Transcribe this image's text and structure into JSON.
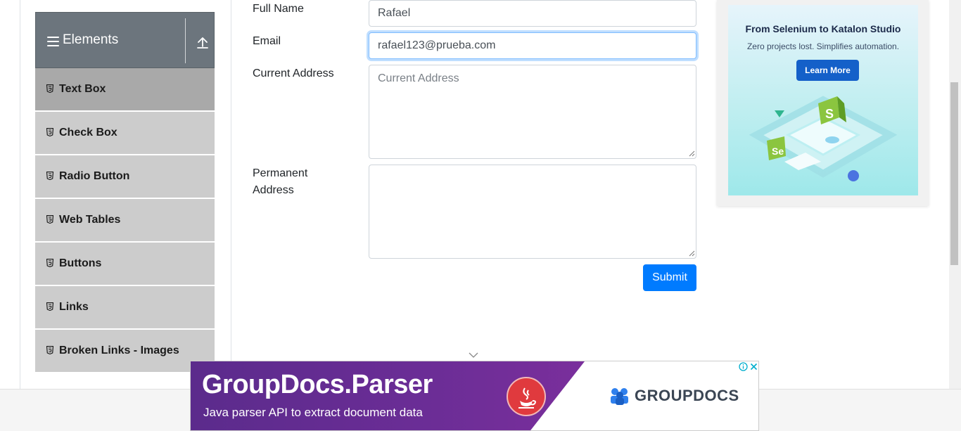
{
  "sidebar": {
    "group_title": "Elements",
    "items": [
      {
        "label": "Text Box",
        "active": true
      },
      {
        "label": "Check Box",
        "active": false
      },
      {
        "label": "Radio Button",
        "active": false
      },
      {
        "label": "Web Tables",
        "active": false
      },
      {
        "label": "Buttons",
        "active": false
      },
      {
        "label": "Links",
        "active": false
      },
      {
        "label": "Broken Links - Images",
        "active": false
      }
    ]
  },
  "form": {
    "full_name_label": "Full Name",
    "full_name_value": "Rafael",
    "email_label": "Email",
    "email_value": "rafael123@prueba.com",
    "current_address_label": "Current Address",
    "current_address_placeholder": "Current Address",
    "permanent_address_label": "Permanent Address",
    "submit_label": "Submit"
  },
  "ad_right": {
    "headline": "From Selenium to Katalon Studio",
    "subtext": "Zero projects lost. Simplifies automation.",
    "cta": "Learn More"
  },
  "ad_bottom": {
    "brand": "GroupDocs.Parser",
    "tagline": "Java parser API to extract document data",
    "logo_text": "GROUPDOCS"
  },
  "colors": {
    "primary": "#007bff",
    "sidebar_header": "#6c757d",
    "menu_item": "#cccccc",
    "menu_item_active": "#a9a9a9"
  }
}
